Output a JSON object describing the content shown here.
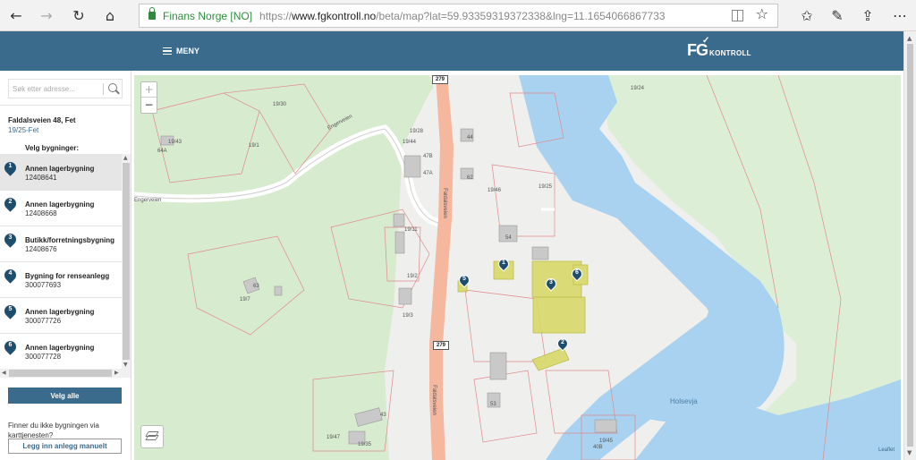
{
  "browser": {
    "site_name": "Finans Norge [NO]",
    "url_prefix": "https://",
    "url_domain": "www.fgkontroll.no",
    "url_path": "/beta/map?lat=59.93359319372338&lng=11.1654066867733"
  },
  "header": {
    "menu_label": "MENY",
    "logo_mark": "FG",
    "logo_sub": "KONTROLL"
  },
  "sidebar": {
    "search_placeholder": "Søk etter adresse...",
    "address": "Faldalsveien 48, Fet",
    "municipality": "19/25-Fet",
    "velg_label": "Velg bygninger:",
    "buildings": [
      {
        "num": "1",
        "name": "Annen lagerbygning",
        "id": "12408641"
      },
      {
        "num": "2",
        "name": "Annen lagerbygning",
        "id": "12408668"
      },
      {
        "num": "3",
        "name": "Butikk/forretningsbygning",
        "id": "12408676"
      },
      {
        "num": "4",
        "name": "Bygning for renseanlegg",
        "id": "300077693"
      },
      {
        "num": "5",
        "name": "Annen lagerbygning",
        "id": "300077726"
      },
      {
        "num": "6",
        "name": "Annen lagerbygning",
        "id": "300077728"
      }
    ],
    "velg_alle": "Velg alle",
    "finner_text": "Finner du ikke bygningen via karttjenesten?",
    "legg_inn": "Legg inn anlegg manuelt"
  },
  "map": {
    "zoom_in": "+",
    "zoom_out": "−",
    "attribution": "Leaflet",
    "road_badge_top": "279",
    "road_badge_bottom": "279",
    "road_engerveien": "Engerveien",
    "road_engerveien2": "Engerveien",
    "road_faldalsveien": "Faldalsveien",
    "road_faldalsveien2": "Faldalsveien",
    "water_label": "Holsevja",
    "parcel_labels": [
      "19/30",
      "19/43",
      "19/1",
      "19/7",
      "19/28",
      "19/25",
      "19/11",
      "19/2",
      "19/3",
      "19/46",
      "19/47",
      "19/45",
      "19/44",
      "19/24",
      "19/35",
      "47B",
      "47A",
      "44",
      "62",
      "64A",
      "40B",
      "43",
      "53",
      "54",
      "63"
    ],
    "pins": [
      "1",
      "2",
      "3",
      "6",
      "5"
    ],
    "colors": {
      "water": "#a9d2f0",
      "forest": "#d8ecd0",
      "road": "#f5b79e",
      "building_selected": "#d8d96a",
      "pin": "#1f4d6e"
    }
  }
}
